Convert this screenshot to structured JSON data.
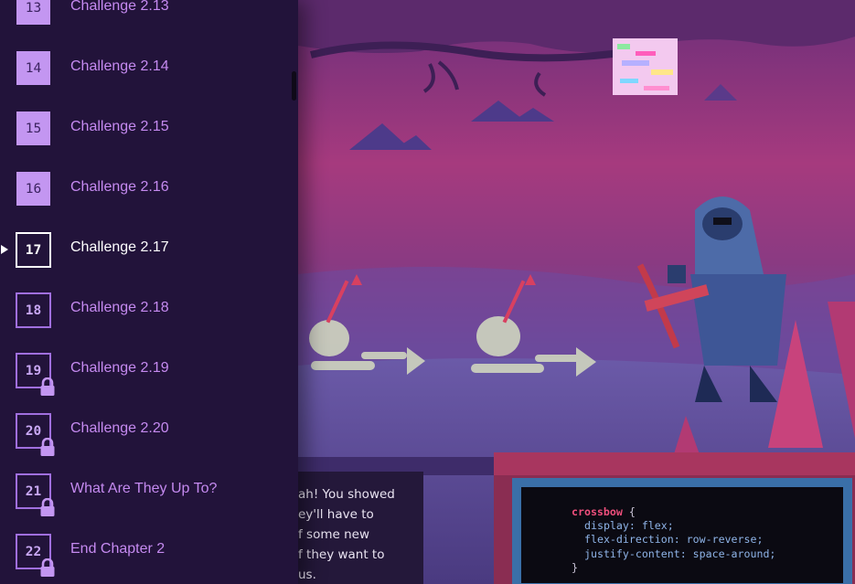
{
  "levels": [
    {
      "number": "13",
      "label": "Challenge 2.13",
      "state": "solved"
    },
    {
      "number": "14",
      "label": "Challenge 2.14",
      "state": "solved"
    },
    {
      "number": "15",
      "label": "Challenge 2.15",
      "state": "solved"
    },
    {
      "number": "16",
      "label": "Challenge 2.16",
      "state": "solved"
    },
    {
      "number": "17",
      "label": "Challenge 2.17",
      "state": "current"
    },
    {
      "number": "18",
      "label": "Challenge 2.18",
      "state": "unlocked"
    },
    {
      "number": "19",
      "label": "Challenge 2.19",
      "state": "locked"
    },
    {
      "number": "20",
      "label": "Challenge 2.20",
      "state": "locked"
    },
    {
      "number": "21",
      "label": "What Are They Up To?",
      "state": "locked"
    },
    {
      "number": "22",
      "label": "End Chapter 2",
      "state": "locked"
    }
  ],
  "dialog": {
    "text": "ah! You showed\ney'll have to\nf some new\nf they want to\nus."
  },
  "code": {
    "selector": "crossbow",
    "open_brace": "{",
    "close_brace": "}",
    "lines": [
      "display: flex;",
      "flex-direction: row-reverse;",
      "justify-content: space-around;"
    ]
  },
  "colors": {
    "sidebar_bg": "#22133a",
    "solved_box": "#c396f1",
    "label_purple": "#c58af0",
    "scene_pink": "#b8417a",
    "scene_purple": "#5a3d86",
    "code_frame": "#3a6fa8",
    "code_selector": "#ef4f7c"
  },
  "icons": {
    "lock": "lock-icon",
    "current_marker": "play-marker-icon"
  }
}
